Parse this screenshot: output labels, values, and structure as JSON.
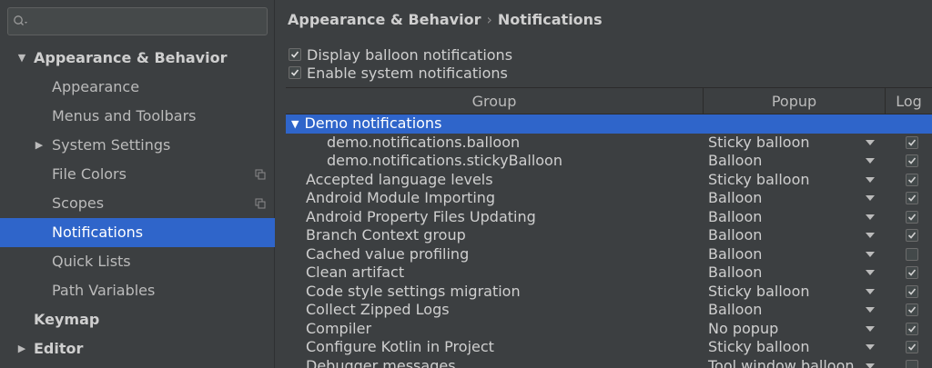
{
  "search": {
    "placeholder": ""
  },
  "sidebar": {
    "items": [
      {
        "label": "Appearance & Behavior",
        "level": 0,
        "expanded": true,
        "bold": true
      },
      {
        "label": "Appearance",
        "level": 1
      },
      {
        "label": "Menus and Toolbars",
        "level": 1
      },
      {
        "label": "System Settings",
        "level": 1,
        "collapsed": true
      },
      {
        "label": "File Colors",
        "level": 1,
        "copy_icon": true
      },
      {
        "label": "Scopes",
        "level": 1,
        "copy_icon": true
      },
      {
        "label": "Notifications",
        "level": 1,
        "selected": true
      },
      {
        "label": "Quick Lists",
        "level": 1
      },
      {
        "label": "Path Variables",
        "level": 1
      },
      {
        "label": "Keymap",
        "level": 0,
        "bold": true
      },
      {
        "label": "Editor",
        "level": 0,
        "bold": true,
        "collapsed": true
      }
    ]
  },
  "breadcrumb": {
    "parent": "Appearance & Behavior",
    "separator": "›",
    "current": "Notifications"
  },
  "options": {
    "display_balloon": {
      "label": "Display balloon notifications",
      "checked": true
    },
    "enable_system": {
      "label": "Enable system notifications",
      "checked": true
    }
  },
  "table": {
    "headers": {
      "group": "Group",
      "popup": "Popup",
      "log": "Log"
    },
    "rows": [
      {
        "name": "Demo notifications",
        "popup": "",
        "log": null,
        "group": true,
        "selected": true
      },
      {
        "name": "demo.notifications.balloon",
        "popup": "Sticky balloon",
        "log": true,
        "indent": 2
      },
      {
        "name": "demo.notifications.stickyBalloon",
        "popup": "Balloon",
        "log": true,
        "indent": 2
      },
      {
        "name": "Accepted language levels",
        "popup": "Sticky balloon",
        "log": true,
        "indent": 1
      },
      {
        "name": "Android Module Importing",
        "popup": "Balloon",
        "log": true,
        "indent": 1
      },
      {
        "name": "Android Property Files Updating",
        "popup": "Balloon",
        "log": true,
        "indent": 1
      },
      {
        "name": "Branch Context group",
        "popup": "Balloon",
        "log": true,
        "indent": 1
      },
      {
        "name": "Cached value profiling",
        "popup": "Balloon",
        "log": false,
        "indent": 1
      },
      {
        "name": "Clean artifact",
        "popup": "Balloon",
        "log": true,
        "indent": 1
      },
      {
        "name": "Code style settings migration",
        "popup": "Sticky balloon",
        "log": true,
        "indent": 1
      },
      {
        "name": "Collect Zipped Logs",
        "popup": "Balloon",
        "log": true,
        "indent": 1
      },
      {
        "name": "Compiler",
        "popup": "No popup",
        "log": true,
        "indent": 1
      },
      {
        "name": "Configure Kotlin in Project",
        "popup": "Sticky balloon",
        "log": true,
        "indent": 1
      },
      {
        "name": "Debugger messages",
        "popup": "Tool window balloon",
        "log": false,
        "indent": 1
      }
    ]
  },
  "colors": {
    "background": "#3c3f41",
    "selection": "#2f65ca",
    "text": "#bbbbbb"
  }
}
